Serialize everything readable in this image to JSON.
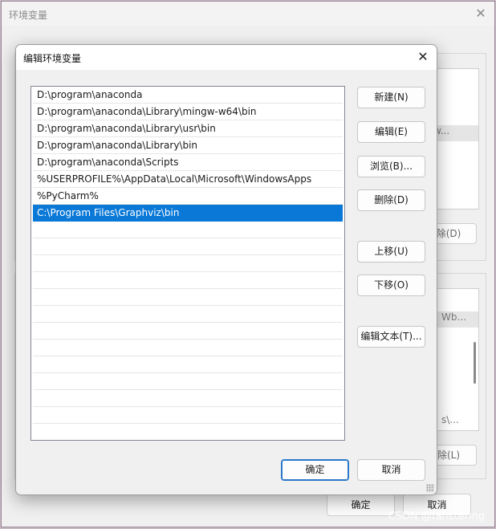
{
  "background_window": {
    "title": "环境变量",
    "close_glyph": "✕",
    "user_list_fragment": "w...",
    "user_delete_label": "除(D)",
    "system_list_fragments": [
      "Wb...",
      "s\\..."
    ],
    "system_delete_label": "除(L)",
    "ok_label": "确定",
    "cancel_label": "取消"
  },
  "dialog": {
    "title": "编辑环境变量",
    "close_glyph": "✕",
    "paths": [
      "D:\\program\\anaconda",
      "D:\\program\\anaconda\\Library\\mingw-w64\\bin",
      "D:\\program\\anaconda\\Library\\usr\\bin",
      "D:\\program\\anaconda\\Library\\bin",
      "D:\\program\\anaconda\\Scripts",
      "%USERPROFILE%\\AppData\\Local\\Microsoft\\WindowsApps",
      "%PyCharm%",
      "C:\\Program Files\\Graphviz\\bin",
      "",
      "",
      "",
      "",
      "",
      "",
      "",
      "",
      "",
      "",
      "",
      "",
      ""
    ],
    "selected_index": 7,
    "buttons": {
      "new": "新建(N)",
      "edit": "编辑(E)",
      "browse": "浏览(B)...",
      "delete": "删除(D)",
      "move_up": "上移(U)",
      "move_down": "下移(O)",
      "edit_text": "编辑文本(T)...",
      "ok": "确定",
      "cancel": "取消"
    }
  },
  "watermark": "CSDN @fanstering",
  "colors": {
    "selection": "#0a78d7",
    "default_button_border": "#2a78c8"
  }
}
